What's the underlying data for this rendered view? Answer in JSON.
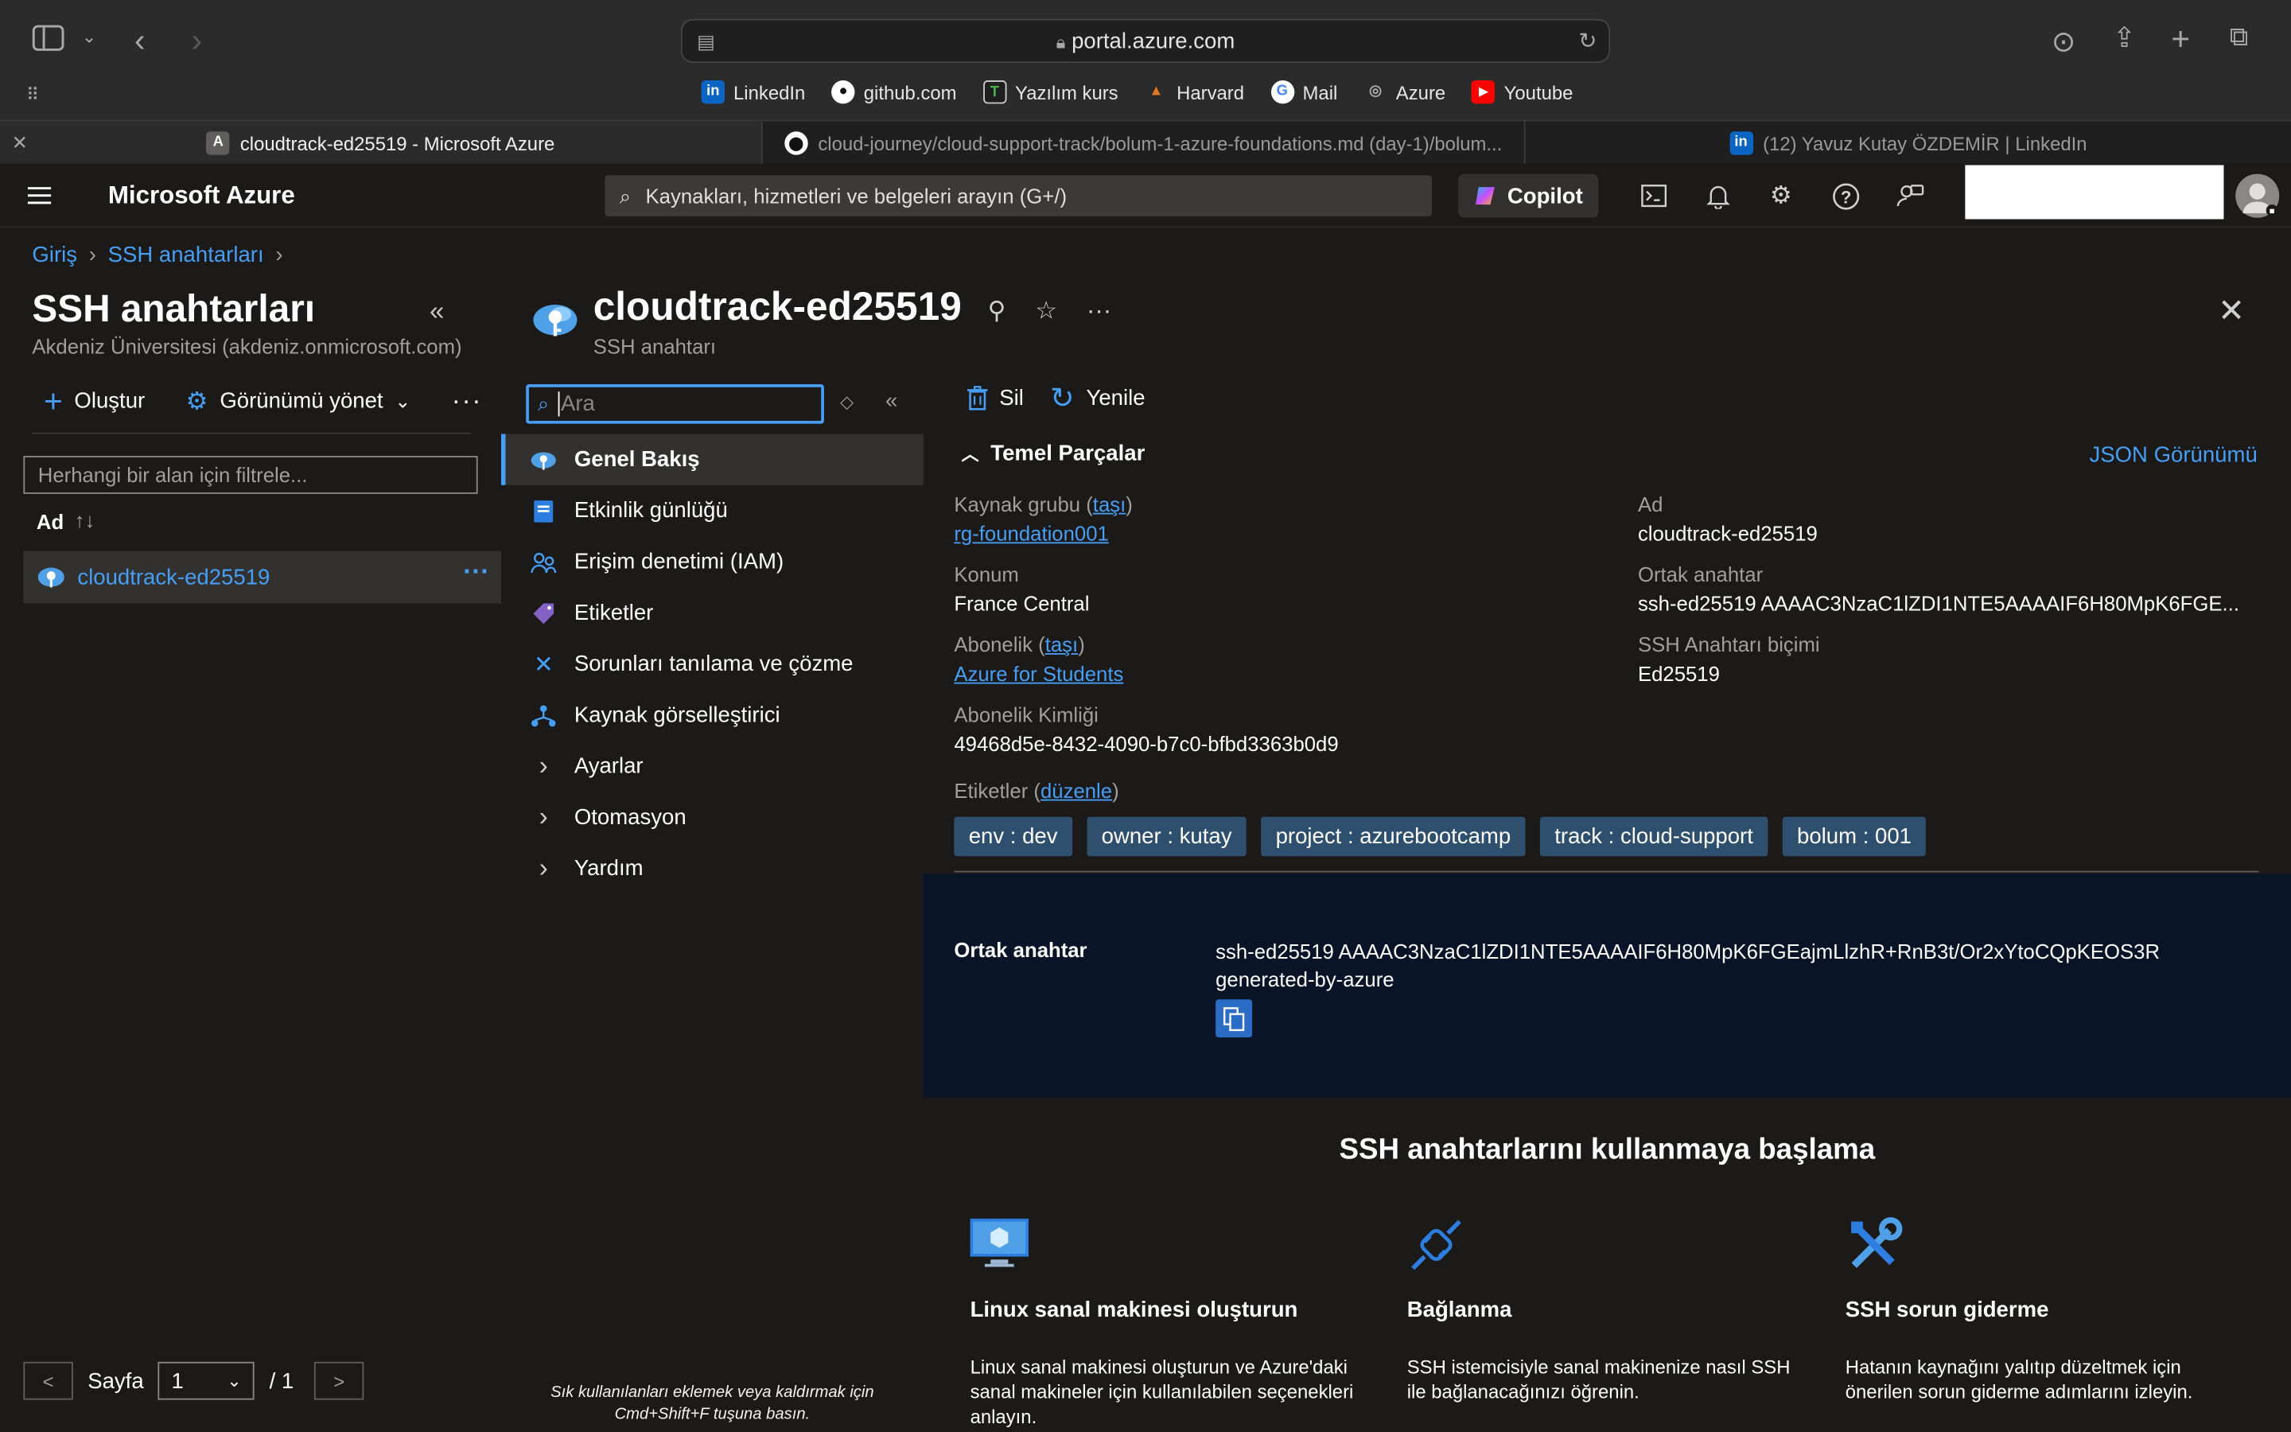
{
  "browser": {
    "url": "portal.azure.com",
    "favorites": [
      {
        "label": "LinkedIn",
        "icon": "linkedin-icon",
        "color": "#0a66c2",
        "glyph": "in"
      },
      {
        "label": "github.com",
        "icon": "github-icon",
        "color": "#333333",
        "glyph": "●"
      },
      {
        "label": "Yazılım kurs",
        "icon": "course-icon",
        "color": "#2e7d32",
        "glyph": "T"
      },
      {
        "label": "Harvard",
        "icon": "rocket-icon",
        "color": "#a51c30",
        "glyph": "▲"
      },
      {
        "label": "Mail",
        "icon": "google-icon",
        "color": "#ffffff",
        "glyph": "G"
      },
      {
        "label": "Azure",
        "icon": "globe-icon",
        "color": "#555555",
        "glyph": "◎"
      },
      {
        "label": "Youtube",
        "icon": "youtube-icon",
        "color": "#ff0000",
        "glyph": "▶"
      }
    ],
    "tabs": [
      {
        "label": "cloudtrack-ed25519 - Microsoft Azure",
        "badge": "A"
      },
      {
        "label": "cloud-journey/cloud-support-track/bolum-1-azure-foundations.md (day-1)/bolum...",
        "badge": "⬤"
      },
      {
        "label": "(12) Yavuz Kutay ÖZDEMİR | LinkedIn",
        "badge": "in"
      }
    ]
  },
  "azure_header": {
    "brand": "Microsoft Azure",
    "search_placeholder": "Kaynakları, hizmetleri ve belgeleri arayın (G+/)",
    "copilot_label": "Copilot"
  },
  "breadcrumb": {
    "home": "Giriş",
    "current": "SSH anahtarları"
  },
  "left_blade": {
    "title": "SSH anahtarları",
    "subtitle": "Akdeniz Üniversitesi (akdeniz.onmicrosoft.com)",
    "create_label": "Oluştur",
    "manage_view_label": "Görünümü yönet",
    "filter_placeholder": "Herhangi bir alan için filtrele...",
    "column_name": "Ad",
    "items": [
      {
        "label": "cloudtrack-ed25519"
      }
    ],
    "pager": {
      "page_label": "Sayfa",
      "page_value": "1",
      "total": "/ 1",
      "prev": "<",
      "next": ">"
    }
  },
  "resource": {
    "title": "cloudtrack-ed25519",
    "subtitle": "SSH anahtarı",
    "menu_search_placeholder": "Ara",
    "menu": [
      {
        "label": "Genel Bakış",
        "icon": "cloud-key-icon",
        "active": true
      },
      {
        "label": "Etkinlik günlüğü",
        "icon": "log-icon"
      },
      {
        "label": "Erişim denetimi (IAM)",
        "icon": "people-icon"
      },
      {
        "label": "Etiketler",
        "icon": "tag-icon"
      },
      {
        "label": "Sorunları tanılama ve çözme",
        "icon": "wrench-icon"
      },
      {
        "label": "Kaynak görselleştirici",
        "icon": "hierarchy-icon"
      },
      {
        "label": "Ayarlar",
        "icon": "chevron-right-icon"
      },
      {
        "label": "Otomasyon",
        "icon": "chevron-right-icon"
      },
      {
        "label": "Yardım",
        "icon": "chevron-right-icon"
      }
    ],
    "menu_footer_line1": "Sık kullanılanları eklemek veya kaldırmak için",
    "menu_footer_line2": "Cmd+Shift+F tuşuna basın.",
    "commands": {
      "delete": "Sil",
      "refresh": "Yenile"
    },
    "essentials_title": "Temel Parçalar",
    "json_view": "JSON Görünümü",
    "essentials_left": {
      "rg_key": "Kaynak grubu",
      "rg_move": "taşı",
      "rg_value": "rg-foundation001",
      "location_key": "Konum",
      "location_value": "France Central",
      "sub_key": "Abonelik",
      "sub_move": "taşı",
      "sub_value": "Azure for Students",
      "subid_key": "Abonelik Kimliği",
      "subid_value": "49468d5e-8432-4090-b7c0-bfbd3363b0d9"
    },
    "essentials_right": {
      "name_key": "Ad",
      "name_value": "cloudtrack-ed25519",
      "pub_key": "Ortak anahtar",
      "pub_value": "ssh-ed25519 AAAAC3NzaC1lZDI1NTE5AAAAIF6H80MpK6FGE...",
      "format_key": "SSH Anahtarı biçimi",
      "format_value": "Ed25519"
    },
    "tags_label": "Etiketler",
    "tags_edit": "düzenle",
    "tags": [
      "env : dev",
      "owner : kutay",
      "project : azurebootcamp",
      "track : cloud-support",
      "bolum : 001"
    ],
    "public_key_panel": {
      "label": "Ortak anahtar",
      "value_line1": "ssh-ed25519 AAAAC3NzaC1lZDI1NTE5AAAAIF6H80MpK6FGEajmLlzhR+RnB3t/Or2xYtoCQpKEOS3R",
      "value_line2": "generated-by-azure"
    },
    "getting_started": {
      "title": "SSH anahtarlarını kullanmaya başlama",
      "cards": [
        {
          "title": "Linux sanal makinesi oluşturun",
          "desc": "Linux sanal makinesi oluşturun ve Azure'daki sanal makineler için kullanılabilen seçenekleri anlayın.",
          "icon": "vm-icon"
        },
        {
          "title": "Bağlanma",
          "desc": "SSH istemcisiyle sanal makinenize nasıl SSH ile bağlanacağınızı öğrenin.",
          "icon": "plug-icon"
        },
        {
          "title": "SSH sorun giderme",
          "desc": "Hatanın kaynağını yalıtıp düzeltmek için önerilen sorun giderme adımlarını izleyin.",
          "icon": "tools-icon"
        }
      ]
    }
  }
}
